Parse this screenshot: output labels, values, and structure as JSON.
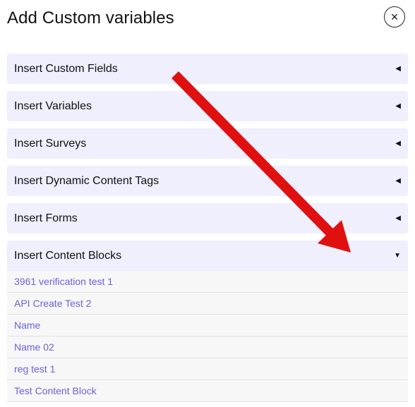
{
  "modal": {
    "title": "Add Custom variables",
    "close_symbol": "×"
  },
  "sections": [
    {
      "label": "Insert Custom Fields",
      "state": "collapsed",
      "caret": "◀"
    },
    {
      "label": "Insert Variables",
      "state": "collapsed",
      "caret": "◀"
    },
    {
      "label": "Insert Surveys",
      "state": "collapsed",
      "caret": "◀"
    },
    {
      "label": "Insert Dynamic Content Tags",
      "state": "collapsed",
      "caret": "◀"
    },
    {
      "label": "Insert Forms",
      "state": "collapsed",
      "caret": "◀"
    },
    {
      "label": "Insert Content Blocks",
      "state": "expanded",
      "caret": "▼"
    }
  ],
  "content_blocks": [
    "3961 verification test 1",
    "API Create Test 2",
    "Name",
    "Name 02",
    "reg test 1",
    "Test Content Block"
  ],
  "colors": {
    "header_bg": "#efeffd",
    "link": "#6a62e0",
    "annotation_arrow": "#e01010"
  },
  "annotation": {
    "icon": "red-arrow",
    "points_to": "Insert Content Blocks caret"
  }
}
